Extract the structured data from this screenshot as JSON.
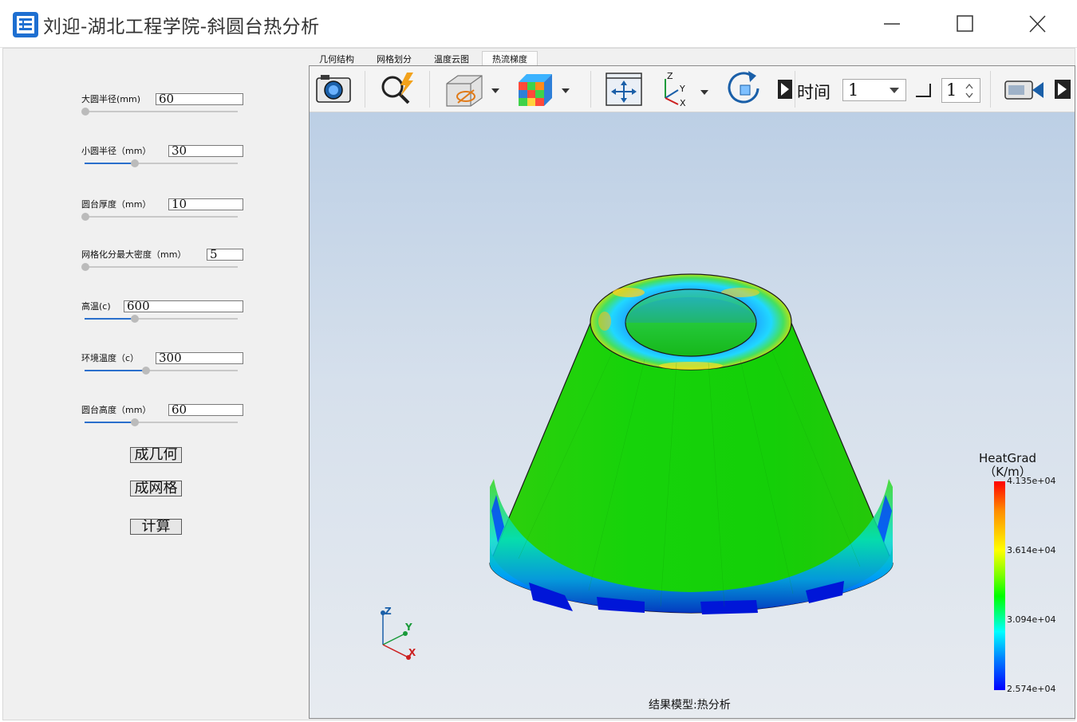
{
  "window": {
    "title": "刘迎-湖北工程学院-斜圆台热分析"
  },
  "params": [
    {
      "label": "大圆半径(mm)",
      "value": "60",
      "slider_fraction": 0.0
    },
    {
      "label": "小圆半径（mm）",
      "value": "30",
      "slider_fraction": 0.33
    },
    {
      "label": "圆台厚度（mm）",
      "value": "10",
      "slider_fraction": 0.0
    },
    {
      "label": "网格化分最大密度（mm）",
      "value": "5",
      "slider_fraction": 0.0
    },
    {
      "label": "高温(c)",
      "value": "600",
      "slider_fraction": 0.33
    },
    {
      "label": "环境温度（c）",
      "value": "300",
      "slider_fraction": 0.4
    },
    {
      "label": "圆台高度（mm）",
      "value": "60",
      "slider_fraction": 0.33
    }
  ],
  "actions": {
    "generate_geometry": "成几何",
    "generate_mesh": "成网格",
    "compute": "计算"
  },
  "tabs": [
    {
      "label": "几何结构",
      "active": false
    },
    {
      "label": "网格划分",
      "active": false
    },
    {
      "label": "温度云图",
      "active": false
    },
    {
      "label": "热流梯度",
      "active": true
    }
  ],
  "toolbar": {
    "icons": [
      "camera-icon",
      "zoom-magic-icon",
      "display-mode-icon",
      "color-cube-icon",
      "fit-view-icon",
      "axes-view-icon",
      "rotate-icon",
      "record-icon"
    ],
    "time_label": "时间",
    "time_value": "1",
    "step_value": "1"
  },
  "viewer": {
    "result_caption": "结果模型:热分析",
    "axes": [
      "Z",
      "Y",
      "X"
    ],
    "legend": {
      "title": "HeatGrad",
      "unit": "（K/m）",
      "ticks": [
        "4.135e+04",
        "3.614e+04",
        "3.094e+04",
        "2.574e+04"
      ]
    }
  },
  "colors": {
    "accent": "#2a6fcc",
    "background": "#f0f0f0",
    "mesh_green": "#1fd40a"
  }
}
